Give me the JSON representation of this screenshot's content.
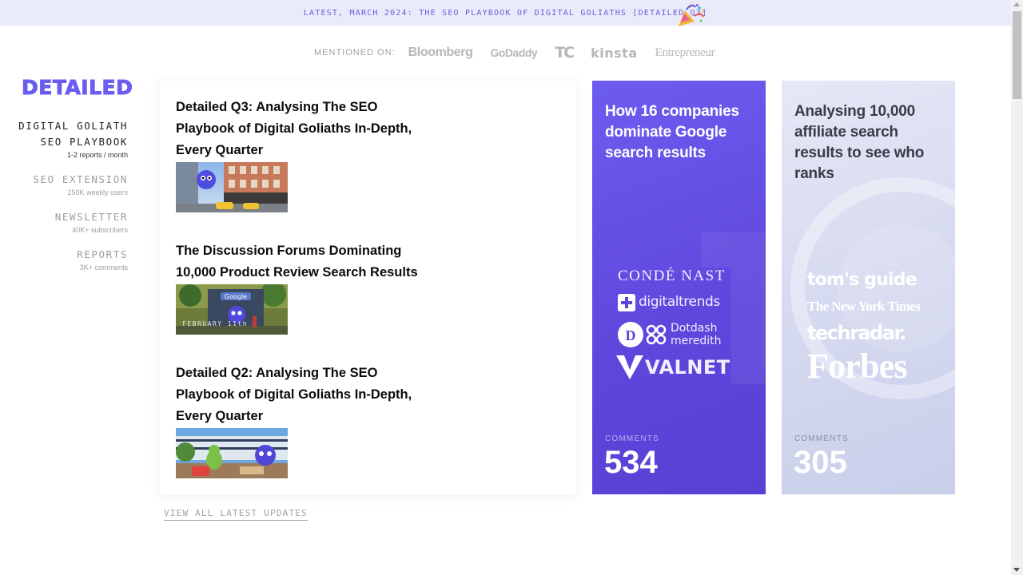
{
  "banner": {
    "text": "LATEST, MARCH 2024: THE SEO PLAYBOOK OF DIGITAL GOLIATHS [DETAILED Q3]"
  },
  "mentions": {
    "label": "MENTIONED ON:",
    "logos": [
      "Bloomberg",
      "GoDaddy",
      "TC",
      "kinsta",
      "Entrepreneur"
    ]
  },
  "brand": {
    "name": "DETAILED"
  },
  "nav": [
    {
      "title_line1": "DIGITAL GOLIATH",
      "title_line2": "SEO PLAYBOOK",
      "sub": "1-2 reports / month"
    },
    {
      "title_line1": "SEO EXTENSION",
      "sub": "250K weekly users"
    },
    {
      "title_line1": "NEWSLETTER",
      "sub": "40K+ subscribers"
    },
    {
      "title_line1": "REPORTS",
      "sub": "3K+ comments"
    }
  ],
  "latest": {
    "articles": [
      {
        "title": "Detailed Q3: Analysing The SEO Playbook of Digital Goliaths In-Depth, Every Quarter"
      },
      {
        "title": "The Discussion Forums Dominating 10,000 Product Review Search Results",
        "thumb_caption": "FEBRUARY 11th"
      },
      {
        "title": "Detailed Q2: Analysing The SEO Playbook of Digital Goliaths In-Depth, Every Quarter"
      }
    ],
    "view_all": "VIEW ALL LATEST UPDATES"
  },
  "cards": [
    {
      "title": "How 16 companies dominate Google search results",
      "publishers": [
        "CONDÉ NAST",
        "digitaltrends",
        "Dotdash meredith",
        "VALNET"
      ],
      "comments_label": "COMMENTS",
      "comments": "534"
    },
    {
      "title": "Analysing 10,000 affiliate search results to see who ranks",
      "publishers": [
        "tom's guide",
        "The New York Times",
        "techradar.",
        "Forbes"
      ],
      "comments_label": "COMMENTS",
      "comments": "305"
    }
  ],
  "colors": {
    "accent": "#6a5ef0",
    "banner_bg": "#e9ebfb",
    "card_purple": "#5e46dc",
    "card_light": "#d6daf0"
  },
  "icons": [
    "party-popper-icon",
    "google-sign-icon"
  ]
}
